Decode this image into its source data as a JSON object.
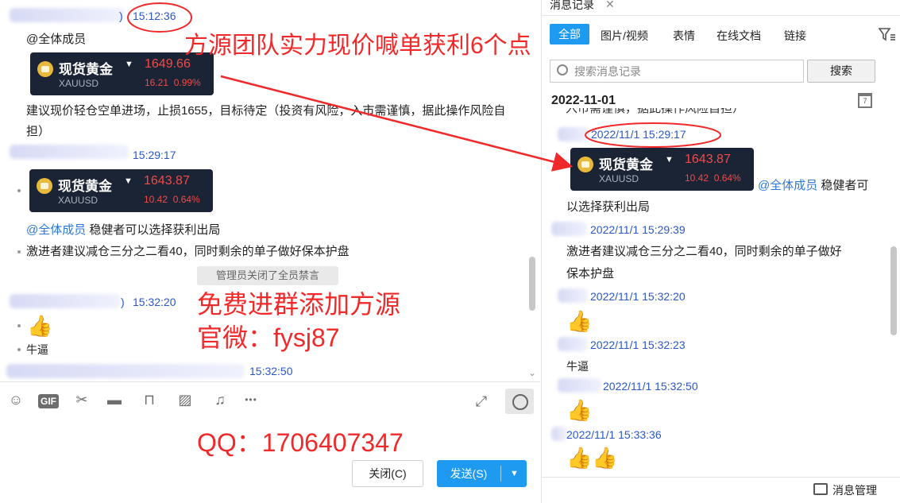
{
  "left_chat": {
    "messages": [
      {
        "time": "15:12:36",
        "mention": "@全体成员"
      },
      {
        "time": "15:29:17"
      },
      {
        "mention": "@全体成员",
        "text": "稳健者可以选择获利出局"
      },
      {
        "text": "激进者建议减仓三分之二看40，同时剩余的单子做好保本护盘"
      },
      {
        "time": "15:32:20",
        "emoji": "👍"
      },
      {
        "text": "牛逼"
      },
      {
        "time": "15:32:50"
      }
    ],
    "advice": "建议现价轻仓空单进场，止损1655，目标待定（投资有风险，入市需谨慎，据此操作风险自担）",
    "paren": ")",
    "card1": {
      "name": "现货黄金",
      "symbol": "XAUUSD",
      "price": "1649.66",
      "change": "16.21",
      "percent": "0.99%"
    },
    "card2": {
      "name": "现货黄金",
      "symbol": "XAUUSD",
      "price": "1643.87",
      "change": "10.42",
      "percent": "0.64%"
    },
    "system_notice": "管理员关闭了全员禁言",
    "toolbar": {
      "gif_label": "GIF",
      "more_label": "•••"
    },
    "buttons": {
      "close_label": "关闭(C)",
      "send_label": "发送(S)"
    }
  },
  "overlay": {
    "headline": "方源团队实力现价喊单获利6个点",
    "join": "免费进群添加方源",
    "wechat": "官微：fysj87",
    "qq": "QQ：1706407347"
  },
  "history": {
    "tab_title": "消息记录",
    "tabs": [
      "全部",
      "图片/视频",
      "表情",
      "在线文档",
      "链接"
    ],
    "search_placeholder": "搜索消息记录",
    "search_button": "搜索",
    "date": "2022-11-01",
    "cal_day": "7",
    "partial_line": "入市需谨慎，据此操作风险自担）",
    "card": {
      "name": "现货黄金",
      "symbol": "XAUUSD",
      "price": "1643.87",
      "change": "10.42",
      "percent": "0.64%"
    },
    "mention": "@全体成员",
    "mention_text_1": "稳健者可",
    "mention_text_2": "以选择获利出局",
    "entries": [
      {
        "time": "2022/11/1 15:29:17"
      },
      {
        "time": "2022/11/1 15:29:39",
        "text1": "激进者建议减仓三分之二看40，同时剩余的单子做好",
        "text2": "保本护盘"
      },
      {
        "time": "2022/11/1 15:32:20",
        "emoji": "👍"
      },
      {
        "time": "2022/11/1 15:32:23",
        "text": "牛逼"
      },
      {
        "time": "2022/11/1 15:32:50",
        "emoji": "👍"
      },
      {
        "time": "2022/11/1 15:33:36",
        "emoji": "👍👍"
      }
    ],
    "footer_label": "消息管理"
  },
  "colors": {
    "accent": "#1e9bf0",
    "overlay_red": "#f02a2a",
    "time_blue": "#2b57c9",
    "card_bg": "#1b2434",
    "price_red": "#f04a4a"
  }
}
